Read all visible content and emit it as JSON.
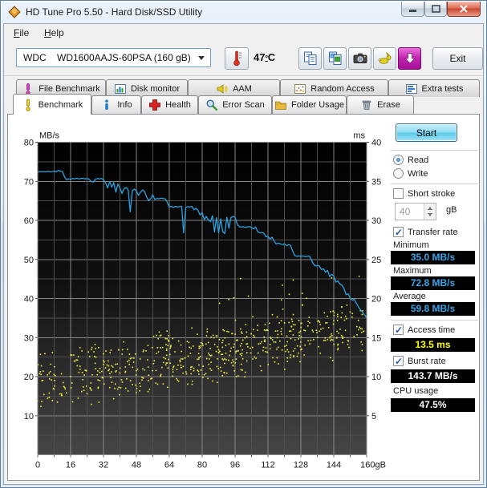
{
  "window": {
    "title": "HD Tune Pro 5.50 - Hard Disk/SSD Utility",
    "controls": [
      "minimize",
      "maximize",
      "close"
    ]
  },
  "menu": {
    "items": [
      {
        "label": "File"
      },
      {
        "label": "Help"
      }
    ]
  },
  "toolbar": {
    "drive_select": "WDC    WD1600AAJS-60PSA (160 gB)",
    "temperature": {
      "value": "47",
      "degree": "º",
      "unit": "C"
    },
    "icons": [
      "thermometer-icon",
      "copy-text-icon",
      "copy-image-icon",
      "camera-icon",
      "speed-rabbit-icon",
      "download-update-icon"
    ],
    "exit_label": "Exit"
  },
  "tabs": {
    "row_back": [
      {
        "label": "File Benchmark",
        "icon": "gauge-pink"
      },
      {
        "label": "Disk monitor",
        "icon": "mini-chart"
      },
      {
        "label": "AAM",
        "icon": "speaker"
      },
      {
        "label": "Random Access",
        "icon": "scatter-box"
      },
      {
        "label": "Extra tests",
        "icon": "bar-chart"
      }
    ],
    "row_front": [
      {
        "label": "Benchmark",
        "icon": "gauge-yellow",
        "active": true
      },
      {
        "label": "Info",
        "icon": "info"
      },
      {
        "label": "Health",
        "icon": "red-cross"
      },
      {
        "label": "Error Scan",
        "icon": "magnifier"
      },
      {
        "label": "Folder Usage",
        "icon": "folder"
      },
      {
        "label": "Erase",
        "icon": "trash"
      }
    ]
  },
  "panel": {
    "start_label": "Start",
    "read_label": "Read",
    "write_label": "Write",
    "short_stroke_label": "Short stroke",
    "capacity_value": "40",
    "capacity_unit": "gB",
    "transfer_rate_label": "Transfer rate",
    "minimum_label": "Minimum",
    "minimum_value": "35.0 MB/s",
    "maximum_label": "Maximum",
    "maximum_value": "72.8 MB/s",
    "average_label": "Average",
    "average_value": "59.8 MB/s",
    "access_time_label": "Access time",
    "access_time_value": "13.5 ms",
    "burst_rate_label": "Burst rate",
    "burst_rate_value": "143.7 MB/s",
    "cpu_usage_label": "CPU usage",
    "cpu_usage_value": "47.5%"
  },
  "chart_data": {
    "type": "line",
    "title": "HD Tune benchmark: transfer rate (line, MB/s) and access time (dots, ms) vs position (gB)",
    "x_axis": {
      "min": 0,
      "max": 160,
      "minor_step": 8,
      "tick_values": [
        0,
        16,
        32,
        48,
        64,
        80,
        96,
        112,
        128,
        144,
        160
      ],
      "tick_labels": [
        "0",
        "16",
        "32",
        "48",
        "64",
        "80",
        "96",
        "112",
        "128",
        "144",
        "160gB"
      ]
    },
    "y_left": {
      "label": "MB/s",
      "min": 0,
      "max": 80,
      "minor_step": 5,
      "ticks": [
        80,
        70,
        60,
        50,
        40,
        30,
        20,
        10
      ]
    },
    "y_right": {
      "label": "ms",
      "min": 0,
      "max": 40,
      "ticks": [
        40,
        35,
        30,
        25,
        20,
        15,
        10,
        5
      ]
    },
    "colors": {
      "line": "#2ba2e2",
      "scatter": "#f0f03c",
      "grid_minor": "#4e4e4e",
      "grid_major": "#878787",
      "bg_top": "#000000",
      "bg_bottom": "#464646",
      "frame": "#8a8a8a",
      "text": "#1a1a1a"
    },
    "series": [
      {
        "name": "Transfer rate",
        "unit": "MB/s",
        "points": [
          [
            0,
            72.3
          ],
          [
            1,
            72.5
          ],
          [
            2,
            72.4
          ],
          [
            3,
            72.5
          ],
          [
            4,
            72.4
          ],
          [
            5,
            72.6
          ],
          [
            6,
            72.4
          ],
          [
            7,
            72.5
          ],
          [
            8,
            72.6
          ],
          [
            9,
            72.4
          ],
          [
            10,
            72.8
          ],
          [
            11,
            72.6
          ],
          [
            12,
            72.5
          ],
          [
            13,
            71.2
          ],
          [
            14,
            70.4
          ],
          [
            15,
            70.6
          ],
          [
            16,
            70.5
          ],
          [
            17,
            70.7
          ],
          [
            18,
            70.6
          ],
          [
            19,
            70.8
          ],
          [
            20,
            70.6
          ],
          [
            21,
            70.7
          ],
          [
            22,
            70.8
          ],
          [
            23,
            70.6
          ],
          [
            24,
            70.7
          ],
          [
            25,
            70.5
          ],
          [
            26,
            70.0
          ],
          [
            27,
            69.8
          ],
          [
            28,
            70.5
          ],
          [
            29,
            70.7
          ],
          [
            30,
            70.6
          ],
          [
            31,
            70.7
          ],
          [
            32,
            70.4
          ],
          [
            33,
            69.6
          ],
          [
            34,
            68.3
          ],
          [
            35,
            69.9
          ],
          [
            36,
            68.5
          ],
          [
            37,
            69.7
          ],
          [
            38,
            67.2
          ],
          [
            39,
            69.3
          ],
          [
            40,
            68.3
          ],
          [
            41,
            66.9
          ],
          [
            42,
            68.1
          ],
          [
            43,
            68.4
          ],
          [
            44,
            67.8
          ],
          [
            45,
            62.2
          ],
          [
            46,
            67.6
          ],
          [
            47,
            68.0
          ],
          [
            48,
            67.5
          ],
          [
            49,
            66.4
          ],
          [
            50,
            67.2
          ],
          [
            51,
            67.8
          ],
          [
            52,
            67.3
          ],
          [
            53,
            66.0
          ],
          [
            54,
            65.0
          ],
          [
            55,
            65.6
          ],
          [
            56,
            66.5
          ],
          [
            57,
            65.3
          ],
          [
            58,
            65.6
          ],
          [
            59,
            65.5
          ],
          [
            60,
            65.7
          ],
          [
            61,
            65.6
          ],
          [
            62,
            65.5
          ],
          [
            63,
            64.7
          ],
          [
            64,
            63.4
          ],
          [
            65,
            63.6
          ],
          [
            66,
            63.3
          ],
          [
            67,
            63.6
          ],
          [
            68,
            63.4
          ],
          [
            69,
            63.5
          ],
          [
            70,
            63.6
          ],
          [
            71,
            56.8
          ],
          [
            72,
            63.3
          ],
          [
            73,
            63.5
          ],
          [
            74,
            63.4
          ],
          [
            75,
            63.6
          ],
          [
            76,
            62.7
          ],
          [
            77,
            63.1
          ],
          [
            78,
            62.5
          ],
          [
            79,
            61.4
          ],
          [
            80,
            62.0
          ],
          [
            81,
            60.2
          ],
          [
            82,
            61.0
          ],
          [
            83,
            60.1
          ],
          [
            84,
            59.7
          ],
          [
            85,
            61.2
          ],
          [
            86,
            57.0
          ],
          [
            87,
            60.7
          ],
          [
            88,
            56.8
          ],
          [
            89,
            60.4
          ],
          [
            90,
            57.1
          ],
          [
            91,
            56.6
          ],
          [
            92,
            60.8
          ],
          [
            93,
            58.0
          ],
          [
            94,
            60.7
          ],
          [
            95,
            61.0
          ],
          [
            96,
            60.8
          ],
          [
            97,
            59.1
          ],
          [
            98,
            58.4
          ],
          [
            99,
            58.3
          ],
          [
            100,
            58.4
          ],
          [
            101,
            58.2
          ],
          [
            102,
            58.3
          ],
          [
            103,
            58.4
          ],
          [
            104,
            58.2
          ],
          [
            105,
            57.8
          ],
          [
            106,
            58.3
          ],
          [
            107,
            57.1
          ],
          [
            108,
            56.8
          ],
          [
            109,
            56.9
          ],
          [
            110,
            56.7
          ],
          [
            111,
            55.8
          ],
          [
            112,
            55.9
          ],
          [
            113,
            55.2
          ],
          [
            114,
            55.7
          ],
          [
            115,
            54.7
          ],
          [
            116,
            53.9
          ],
          [
            117,
            54.2
          ],
          [
            118,
            54.0
          ],
          [
            119,
            53.8
          ],
          [
            120,
            54.0
          ],
          [
            121,
            53.5
          ],
          [
            122,
            53.8
          ],
          [
            123,
            53.6
          ],
          [
            124,
            52.1
          ],
          [
            125,
            51.0
          ],
          [
            126,
            50.8
          ],
          [
            127,
            50.9
          ],
          [
            128,
            50.8
          ],
          [
            129,
            50.9
          ],
          [
            130,
            50.7
          ],
          [
            131,
            50.8
          ],
          [
            132,
            50.9
          ],
          [
            133,
            50.1
          ],
          [
            134,
            48.9
          ],
          [
            135,
            48.3
          ],
          [
            136,
            48.5
          ],
          [
            137,
            48.3
          ],
          [
            138,
            47.4
          ],
          [
            139,
            47.6
          ],
          [
            140,
            46.7
          ],
          [
            141,
            47.2
          ],
          [
            142,
            45.6
          ],
          [
            143,
            46.2
          ],
          [
            144,
            45.8
          ],
          [
            145,
            44.2
          ],
          [
            146,
            44.5
          ],
          [
            147,
            43.7
          ],
          [
            148,
            43.4
          ],
          [
            149,
            42.5
          ],
          [
            150,
            41.0
          ],
          [
            151,
            41.2
          ],
          [
            152,
            40.1
          ],
          [
            153,
            39.6
          ],
          [
            154,
            39.8
          ],
          [
            155,
            38.8
          ],
          [
            156,
            37.8
          ],
          [
            157,
            37.1
          ],
          [
            158,
            36.5
          ],
          [
            159,
            35.8
          ],
          [
            160,
            35.1
          ]
        ]
      }
    ],
    "access_time_scatter": {
      "name": "Access time",
      "unit": "ms",
      "seed": 21,
      "count": 640,
      "ms_base_start": 9.2,
      "ms_base_end": 16.5,
      "spread": 4.3,
      "clip": [
        3.2,
        23.2
      ]
    }
  },
  "icons": {
    "check": "✓"
  }
}
